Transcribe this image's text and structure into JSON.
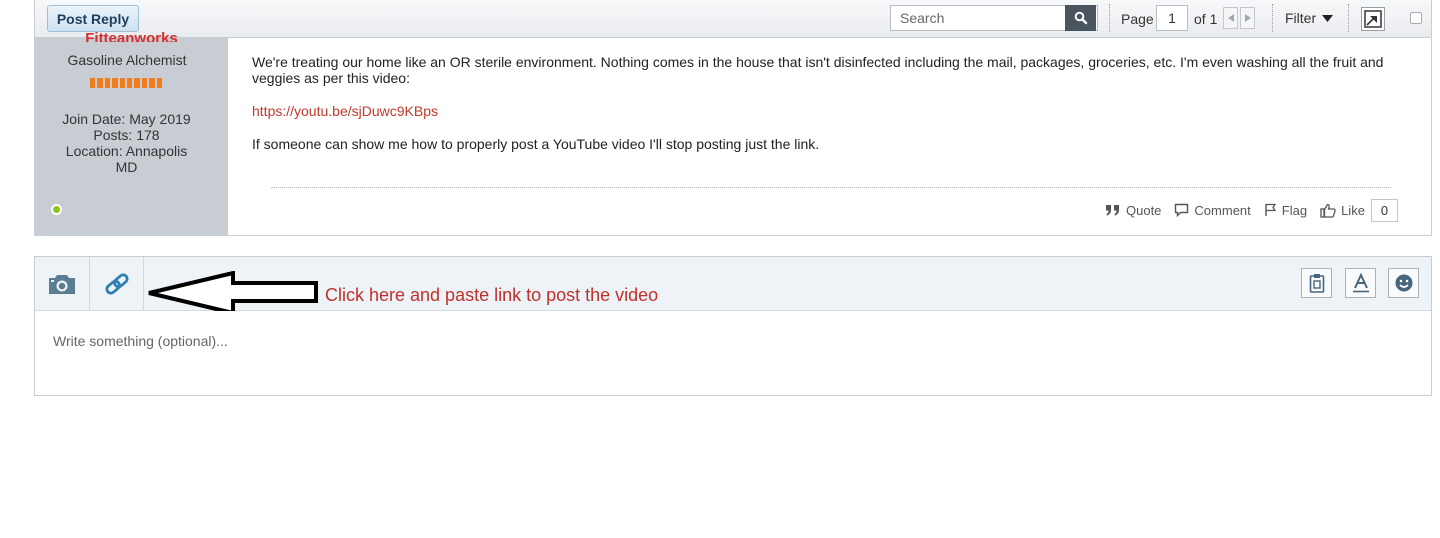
{
  "toolbar": {
    "post_reply_label": "Post Reply",
    "search_placeholder": "Search",
    "page_label": "Page",
    "page_value": "1",
    "page_of": "of 1",
    "filter_label": "Filter"
  },
  "post": {
    "author": {
      "name": "Fitteanworks",
      "rank": "Gasoline Alchemist",
      "join_date": "Join Date: May 2019",
      "posts": "Posts: 178",
      "location_line1": "Location: Annapolis",
      "location_line2": "MD",
      "online_status_color": "#8fc31f"
    },
    "paragraph1": "We're treating our home like an OR sterile environment. Nothing comes in the house that isn't disinfected including the mail, packages, groceries, etc. I'm even washing all the fruit and veggies as per this video:",
    "link": "https://youtu.be/sjDuwc9KBps",
    "paragraph2": "If someone can show me how to properly post a YouTube video I'll stop posting just the link.",
    "actions": {
      "quote": "Quote",
      "comment": "Comment",
      "flag": "Flag",
      "like": "Like",
      "like_count": "0"
    }
  },
  "reply": {
    "annotation": "Click here and paste link to post the video",
    "placeholder": "Write something (optional)..."
  },
  "colors": {
    "accent_link": "#c0392b",
    "annotation": "#c0302c",
    "icon_blue": "#2f7fb0",
    "rank_bar": "#f07d1a"
  }
}
